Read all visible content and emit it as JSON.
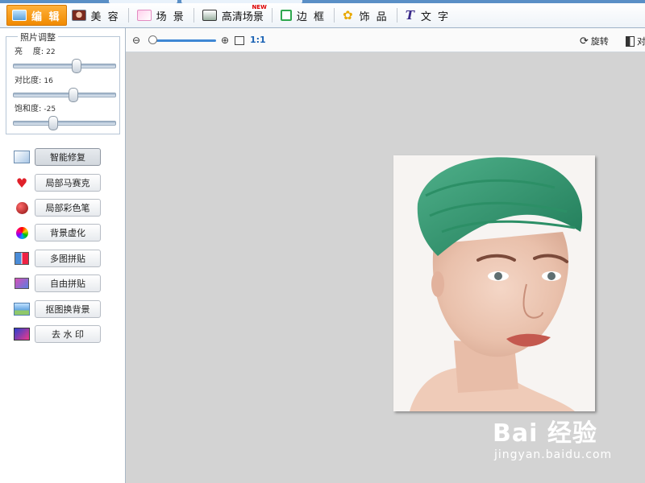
{
  "toolbar": {
    "items": [
      {
        "label": "编 辑",
        "icon": "landscape-icon",
        "active": true
      },
      {
        "label": "美 容",
        "icon": "face-icon"
      },
      {
        "label": "场 景",
        "icon": "scene-icon"
      },
      {
        "label": "高清场景",
        "icon": "hd-scene-icon",
        "badge": "NEW"
      },
      {
        "label": "边 框",
        "icon": "frame-icon"
      },
      {
        "label": "饰 品",
        "icon": "clover-icon"
      },
      {
        "label": "文 字",
        "icon": "text-icon"
      }
    ]
  },
  "adjust": {
    "title": "照片调整",
    "brightness": {
      "label": "亮    度:",
      "value": "22",
      "level": 0.61
    },
    "contrast": {
      "label": "对比度:",
      "value": "16",
      "level": 0.58
    },
    "saturation": {
      "label": "饱和度:",
      "value": "-25",
      "level": 0.38
    }
  },
  "tools": [
    {
      "label": "智能修复",
      "icon": "magic-wand-icon",
      "selected": true
    },
    {
      "label": "局部马赛克",
      "icon": "mosaic-heart-icon"
    },
    {
      "label": "局部彩色笔",
      "icon": "apple-icon"
    },
    {
      "label": "背景虚化",
      "icon": "color-dots-icon"
    },
    {
      "label": "多图拼贴",
      "icon": "grid-collage-icon"
    },
    {
      "label": "自由拼贴",
      "icon": "free-collage-icon"
    },
    {
      "label": "抠图换背景",
      "icon": "cutout-icon"
    },
    {
      "label": "去 水 印",
      "icon": "watermark-remove-icon"
    }
  ],
  "canvas_bar": {
    "zoom_level": 0.05,
    "one_to_one": "1:1",
    "rotate_label": "旋转",
    "contrast_label": "对"
  },
  "watermark": {
    "main": "Bai 经验",
    "sub": "jingyan.baidu.com"
  },
  "colors": {
    "accent": "#f08a00",
    "zoom_track": "#3f87d4",
    "canvas_bg": "#d3d3d3"
  }
}
